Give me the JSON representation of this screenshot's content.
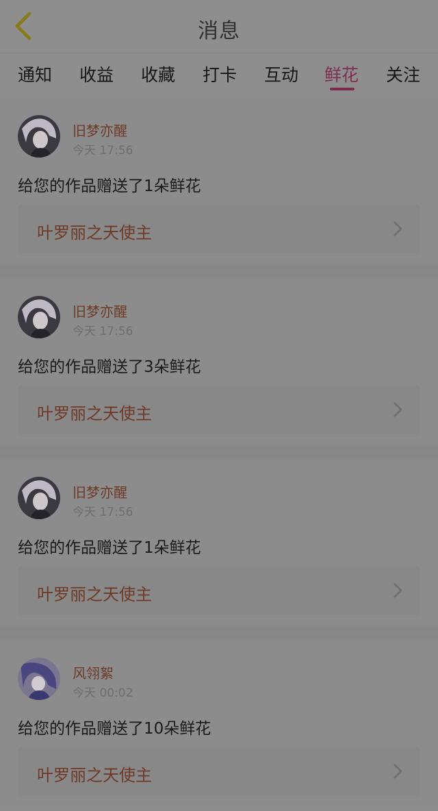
{
  "header": {
    "title": "消息",
    "back_icon": "chevron-left-icon"
  },
  "tabs": [
    {
      "label": "通知",
      "active": false
    },
    {
      "label": "收益",
      "active": false
    },
    {
      "label": "收藏",
      "active": false
    },
    {
      "label": "打卡",
      "active": false
    },
    {
      "label": "互动",
      "active": false
    },
    {
      "label": "鲜花",
      "active": true
    },
    {
      "label": "关注",
      "active": false
    }
  ],
  "messages": [
    {
      "user": "旧梦亦醒",
      "time": "今天 17:56",
      "text": "给您的作品赠送了1朵鲜花",
      "work": "叶罗丽之天使主"
    },
    {
      "user": "旧梦亦醒",
      "time": "今天 17:56",
      "text": "给您的作品赠送了3朵鲜花",
      "work": "叶罗丽之天使主"
    },
    {
      "user": "旧梦亦醒",
      "time": "今天 17:56",
      "text": "给您的作品赠送了1朵鲜花",
      "work": "叶罗丽之天使主"
    },
    {
      "user": "风翎絮",
      "time": "今天 00:02",
      "text": "给您的作品赠送了10朵鲜花",
      "work": "叶罗丽之天使主"
    }
  ],
  "colors": {
    "accent": "#7a2a4a",
    "name_text": "#6e3a26",
    "back_arrow": "#8a7a1e"
  }
}
